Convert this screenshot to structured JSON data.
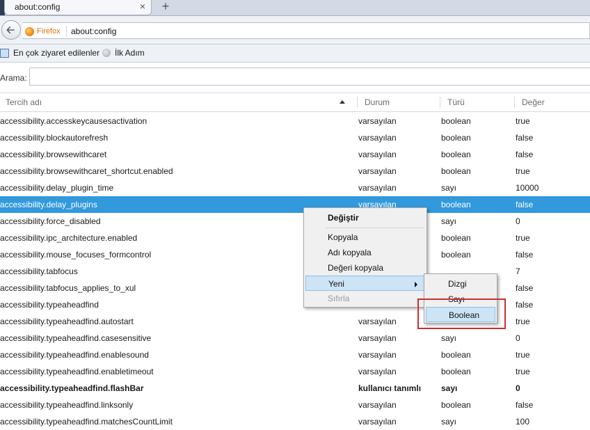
{
  "tab": {
    "title": "about:config",
    "close": "×",
    "new": "+"
  },
  "nav": {
    "identity": "Firefox",
    "url": "about:config"
  },
  "bookmarks": [
    {
      "label": "En çok ziyaret edilenler"
    },
    {
      "label": "İlk Adım"
    }
  ],
  "search": {
    "label": "Arama:",
    "value": ""
  },
  "columns": [
    "Tercih adı",
    "Durum",
    "Türü",
    "Değer"
  ],
  "rows": [
    {
      "name": "accessibility.accesskeycausesactivation",
      "status": "varsayılan",
      "type": "boolean",
      "value": "true"
    },
    {
      "name": "accessibility.blockautorefresh",
      "status": "varsayılan",
      "type": "boolean",
      "value": "false"
    },
    {
      "name": "accessibility.browsewithcaret",
      "status": "varsayılan",
      "type": "boolean",
      "value": "false"
    },
    {
      "name": "accessibility.browsewithcaret_shortcut.enabled",
      "status": "varsayılan",
      "type": "boolean",
      "value": "true"
    },
    {
      "name": "accessibility.delay_plugin_time",
      "status": "varsayılan",
      "type": "sayı",
      "value": "10000"
    },
    {
      "name": "accessibility.delay_plugins",
      "status": "varsayılan",
      "type": "boolean",
      "value": "false",
      "selected": true
    },
    {
      "name": "accessibility.force_disabled",
      "status": "",
      "type": "sayı",
      "value": "0"
    },
    {
      "name": "accessibility.ipc_architecture.enabled",
      "status": "",
      "type": "boolean",
      "value": "true"
    },
    {
      "name": "accessibility.mouse_focuses_formcontrol",
      "status": "",
      "type": "boolean",
      "value": "false"
    },
    {
      "name": "accessibility.tabfocus",
      "status": "",
      "type": "",
      "value": "7"
    },
    {
      "name": "accessibility.tabfocus_applies_to_xul",
      "status": "",
      "type": "",
      "value": "false"
    },
    {
      "name": "accessibility.typeaheadfind",
      "status": "",
      "type": "",
      "value": "false"
    },
    {
      "name": "accessibility.typeaheadfind.autostart",
      "status": "varsayılan",
      "type": "",
      "value": "true"
    },
    {
      "name": "accessibility.typeaheadfind.casesensitive",
      "status": "varsayılan",
      "type": "sayı",
      "value": "0"
    },
    {
      "name": "accessibility.typeaheadfind.enablesound",
      "status": "varsayılan",
      "type": "boolean",
      "value": "true"
    },
    {
      "name": "accessibility.typeaheadfind.enabletimeout",
      "status": "varsayılan",
      "type": "boolean",
      "value": "true"
    },
    {
      "name": "accessibility.typeaheadfind.flashBar",
      "status": "kullanıcı tanımlı",
      "type": "sayı",
      "value": "0",
      "bold": true
    },
    {
      "name": "accessibility.typeaheadfind.linksonly",
      "status": "varsayılan",
      "type": "boolean",
      "value": "false"
    },
    {
      "name": "accessibility.typeaheadfind.matchesCountLimit",
      "status": "varsayılan",
      "type": "sayı",
      "value": "100"
    }
  ],
  "context_menu": {
    "items": [
      "Değiştir",
      "Kopyala",
      "Adı kopyala",
      "Değeri kopyala",
      "Yeni",
      "Sıfırla"
    ],
    "submenu": [
      "Dizgi",
      "Sayı",
      "Boolean"
    ]
  },
  "colors": {
    "selection": "#3299dd",
    "highlight_box": "#c9302c",
    "menu_hover": "#cde4f7"
  }
}
